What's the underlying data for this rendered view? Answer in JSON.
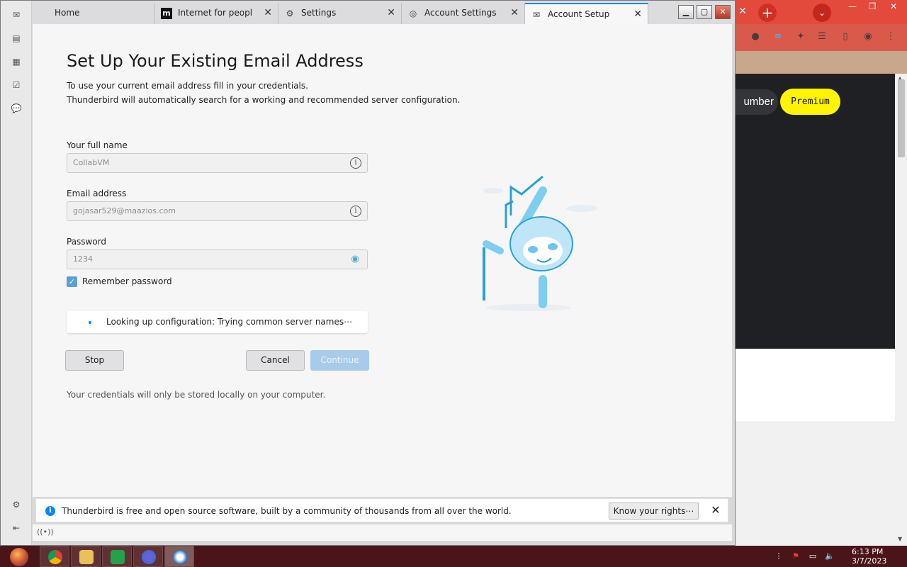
{
  "thunderbird": {
    "tabs": [
      {
        "label": "Home",
        "icon": "mail-icon"
      },
      {
        "label": "Internet for people..",
        "icon": "mozilla-m-icon"
      },
      {
        "label": "Settings",
        "icon": "gear-icon"
      },
      {
        "label": "Account Settings",
        "icon": "account-icon"
      },
      {
        "label": "Account Setup",
        "icon": "mail-icon"
      }
    ],
    "setup": {
      "title": "Set Up Your Existing Email Address",
      "desc_line1": "To use your current email address fill in your credentials.",
      "desc_line2": "Thunderbird will automatically search for a working and recommended server configuration.",
      "name_label": "Your full name",
      "name_value": "CollabVM",
      "email_label": "Email address",
      "email_value": "gojasar529@maazios.com",
      "password_label": "Password",
      "password_value": "1234",
      "remember_label": "Remember password",
      "remember_checked": true,
      "status_text": "Looking up configuration: Trying common server names⋯",
      "stop_label": "Stop",
      "cancel_label": "Cancel",
      "continue_label": "Continue",
      "note": "Your credentials will only be stored locally on your computer."
    },
    "notification": {
      "text": "Thunderbird is free and open source software, built by a community of thousands from all over the world.",
      "button_label": "Know your rights⋯"
    }
  },
  "chrome": {
    "number_label": "umber",
    "premium_label": "Premium"
  },
  "taskbar": {
    "time": "6:13 PM",
    "date": "3/7/2023"
  },
  "colors": {
    "accent": "#0a84ff",
    "continue_disabled": "#a8cbea",
    "premium": "#fff500",
    "chrome_red": "#e34a3b"
  }
}
